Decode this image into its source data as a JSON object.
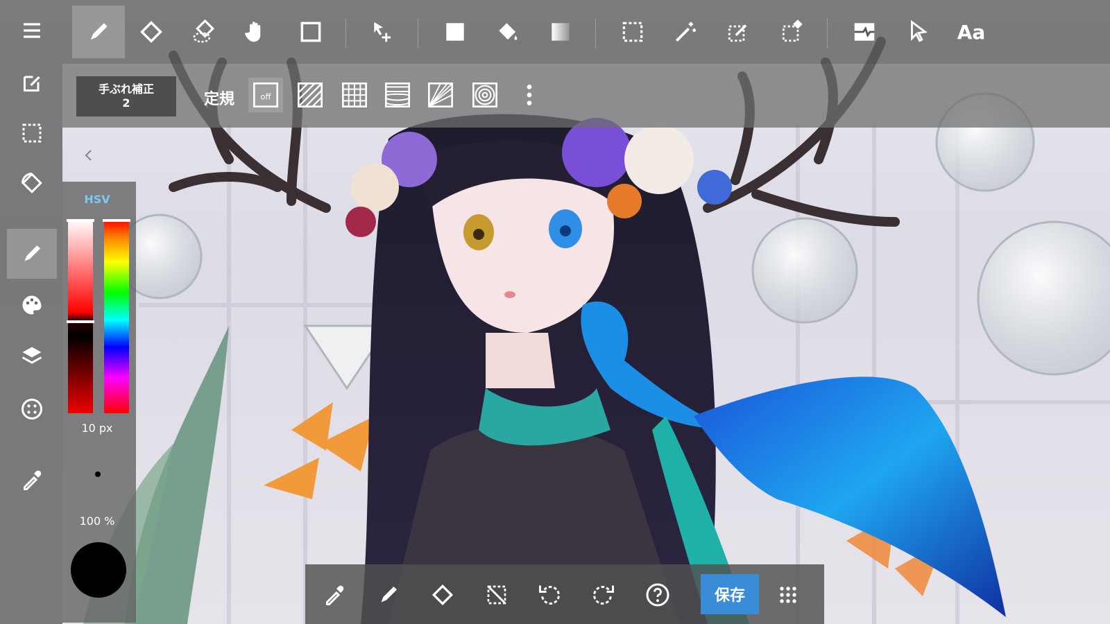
{
  "colors": {
    "accent": "#3a8cd6",
    "hsv_label": "#7ec8f2",
    "current_color": "#000000",
    "toolbar_bg": "#5f5f5f"
  },
  "top_toolbar": {
    "tools": [
      "pen-icon",
      "eraser-icon",
      "blur-icon",
      "hand-icon",
      "rectangle-icon",
      "move-icon",
      "fill-rect-icon",
      "bucket-icon",
      "gradient-icon",
      "select-rect-icon",
      "magic-wand-icon",
      "select-pen-icon",
      "select-eraser-icon",
      "filter-icon",
      "pointer-icon",
      "text-icon"
    ],
    "text_tool_label": "Aa"
  },
  "sub_toolbar": {
    "stabilizer_label": "手ぶれ補正",
    "stabilizer_value": "2",
    "ruler_label": "定規",
    "ruler_options": [
      "ruler-off-icon",
      "ruler-parallel-icon",
      "ruler-grid-icon",
      "ruler-perspective-icon",
      "ruler-radial-icon",
      "ruler-concentric-icon",
      "more-icon"
    ],
    "ruler_off_text": "off"
  },
  "left_toolbar": {
    "items": [
      "menu-icon",
      "edit-icon",
      "selection-icon",
      "rotate-icon",
      "brush-icon",
      "palette-icon",
      "layers-icon",
      "material-icon",
      "eyedropper-icon"
    ],
    "active": "brush-icon"
  },
  "color_panel": {
    "mode": "HSV",
    "brush_size": "10 px",
    "opacity": "100 %"
  },
  "bottom_toolbar": {
    "tools": [
      "eyedropper-icon",
      "pen-icon",
      "eraser-icon",
      "clear-icon",
      "undo-icon",
      "redo-icon",
      "help-icon"
    ],
    "save_label": "保存",
    "grid_icon": "grid-icon"
  }
}
